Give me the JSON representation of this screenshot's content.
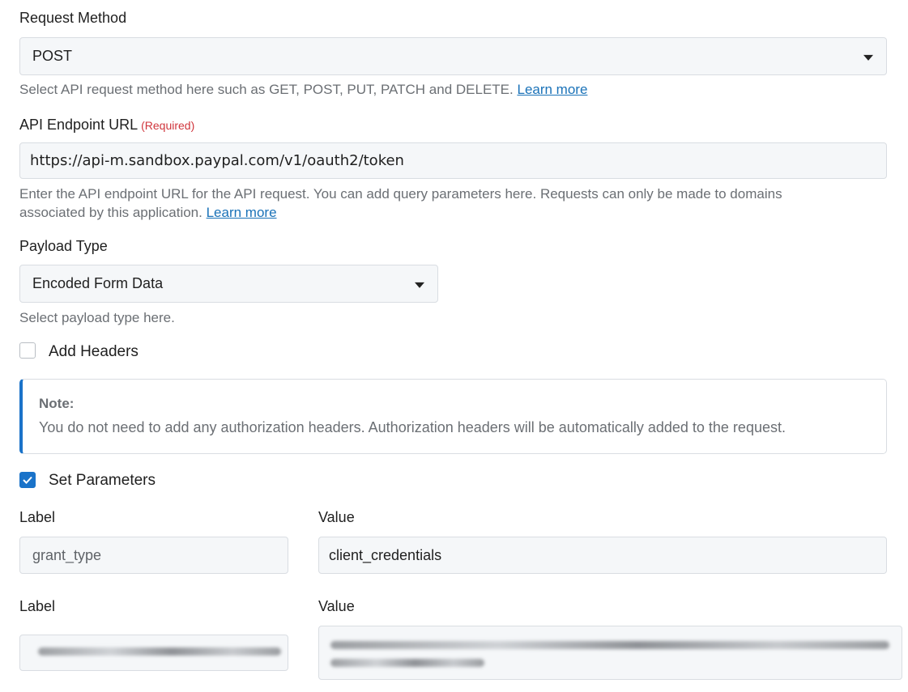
{
  "request_method": {
    "label": "Request Method",
    "value": "POST",
    "help": "Select API request method here such as GET, POST, PUT, PATCH and DELETE.",
    "learn_more": "Learn more"
  },
  "endpoint": {
    "label": "API Endpoint URL",
    "required": "(Required)",
    "value": "https://api-m.sandbox.paypal.com/v1/oauth2/token",
    "help_line1": "Enter the API endpoint URL for the API request. You can add query parameters here. Requests can only be made to domains",
    "help_line2": "associated by this application.",
    "learn_more": "Learn more"
  },
  "payload_type": {
    "label": "Payload Type",
    "value": "Encoded Form Data",
    "help": "Select payload type here."
  },
  "add_headers": {
    "label": "Add Headers",
    "checked": false
  },
  "note": {
    "title": "Note:",
    "text": "You do not need to add any authorization headers. Authorization headers will be automatically added to the request."
  },
  "set_parameters": {
    "label": "Set Parameters",
    "checked": true
  },
  "parameters": [
    {
      "label_heading": "Label",
      "value_heading": "Value",
      "label": "grant_type",
      "value": "client_credentials"
    },
    {
      "label_heading": "Label",
      "value_heading": "Value",
      "label": "",
      "value": ""
    }
  ],
  "colors": {
    "accent": "#1a73c9",
    "link": "#1a72b8",
    "required": "#d0353c",
    "field_bg": "#f5f7f9"
  },
  "icons": {
    "dropdown": "caret-down-icon",
    "check": "checkmark-icon"
  }
}
